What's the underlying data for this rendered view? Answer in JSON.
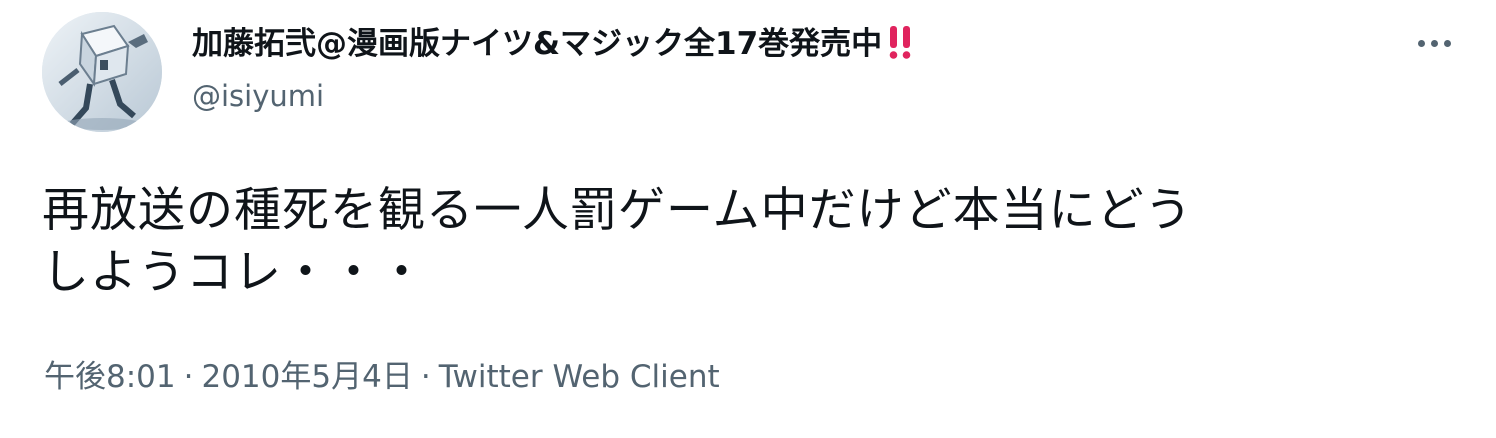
{
  "tweet": {
    "author": {
      "display_name": "加藤拓弐@漫画版ナイツ&マジック全17巻発売中",
      "badge_icon": "double-exclamation-icon",
      "badge_color": "#e0245e",
      "handle": "@isiyumi"
    },
    "more_icon": "more-horizontal-icon",
    "text_lines": [
      "再放送の種死を観る一人罰ゲーム中だけど本当にどう",
      "しようコレ・・・"
    ],
    "time": "午後8:01",
    "date": "2010年5月4日",
    "separator": "·",
    "source": "Twitter Web Client"
  }
}
